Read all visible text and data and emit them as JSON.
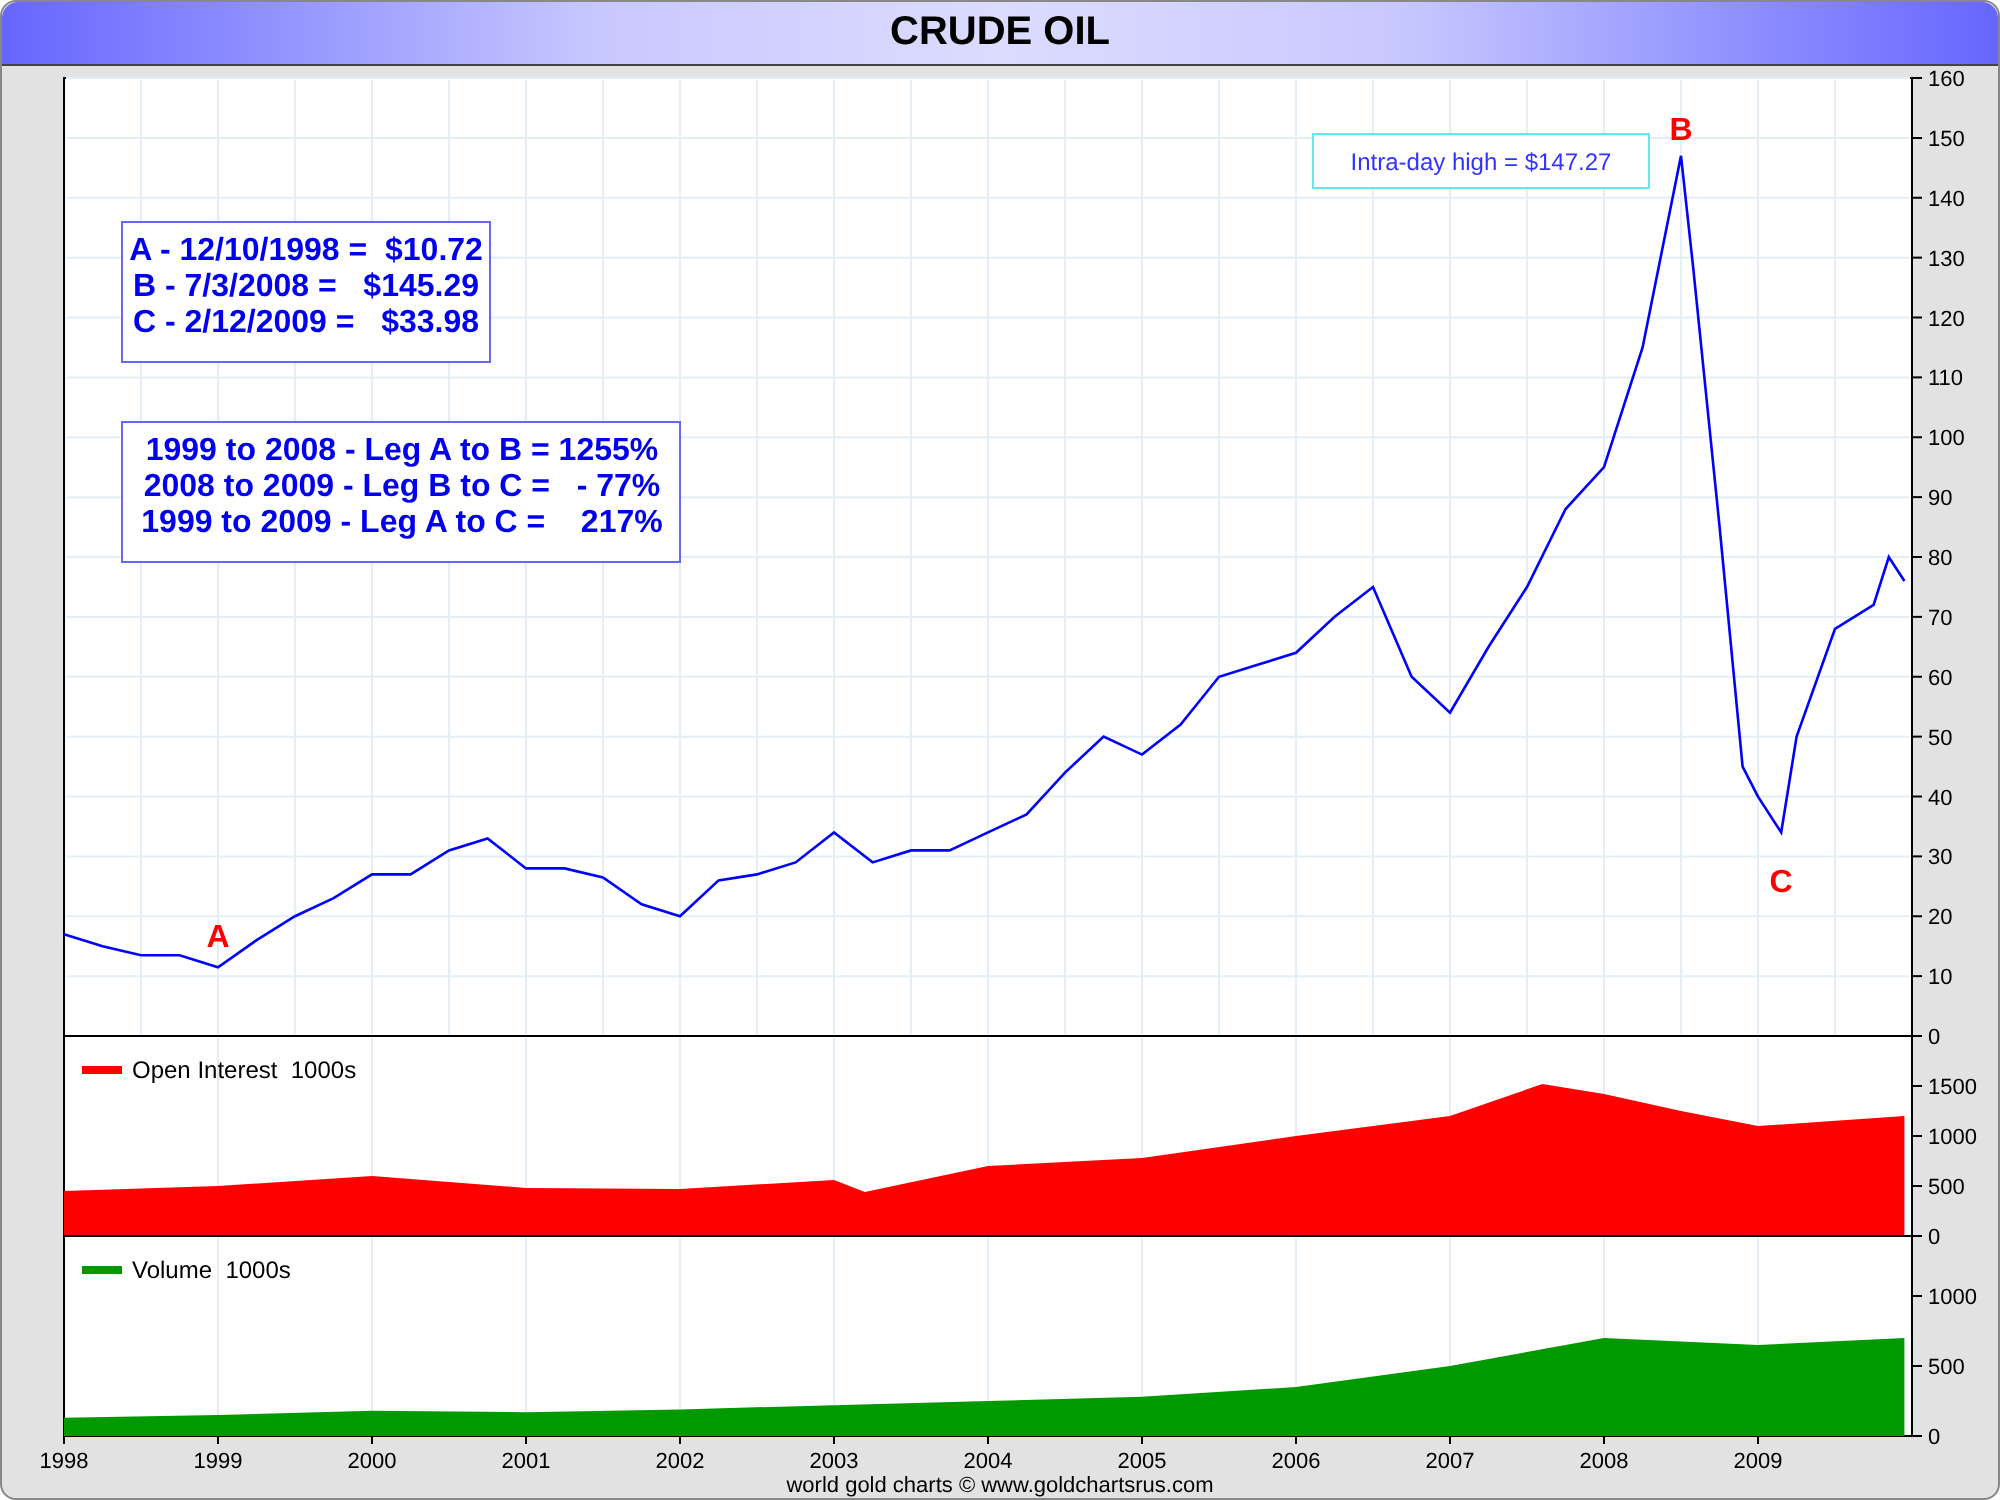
{
  "title": "CRUDE OIL",
  "price_chart": {
    "chart_data": {
      "type": "line",
      "grid": true,
      "xlim": [
        1998,
        2010
      ],
      "ylim": [
        0,
        160
      ],
      "yticks": [
        0,
        10,
        20,
        30,
        40,
        50,
        60,
        70,
        80,
        90,
        100,
        110,
        120,
        130,
        140,
        150,
        160
      ],
      "x": [
        1998.0,
        1998.25,
        1998.5,
        1998.75,
        1999.0,
        1999.25,
        1999.5,
        1999.75,
        2000.0,
        2000.25,
        2000.5,
        2000.75,
        2001.0,
        2001.25,
        2001.5,
        2001.75,
        2002.0,
        2002.25,
        2002.5,
        2002.75,
        2003.0,
        2003.25,
        2003.5,
        2003.75,
        2004.0,
        2004.25,
        2004.5,
        2004.75,
        2005.0,
        2005.25,
        2005.5,
        2005.75,
        2006.0,
        2006.25,
        2006.5,
        2006.75,
        2007.0,
        2007.25,
        2007.5,
        2007.75,
        2008.0,
        2008.25,
        2008.5,
        2008.58,
        2008.75,
        2008.9,
        2009.0,
        2009.15,
        2009.25,
        2009.5,
        2009.75,
        2009.85,
        2009.95
      ],
      "series": [
        {
          "color": "#0000ff",
          "values": [
            17,
            15,
            13.5,
            13.5,
            11.5,
            16,
            20,
            23,
            27,
            27,
            31,
            33,
            28,
            28,
            26.5,
            22,
            20,
            26,
            27,
            29,
            34,
            29,
            31,
            31,
            34,
            37,
            44,
            50,
            47,
            52,
            60,
            62,
            64,
            70,
            75,
            60,
            54,
            65,
            75,
            88,
            95,
            115,
            147,
            128,
            85,
            45,
            40,
            34,
            50,
            68,
            72,
            80,
            76
          ]
        }
      ],
      "annotations": [
        "A",
        "B",
        "C",
        "Intra-day high = $147.27"
      ]
    },
    "price_box": [
      "A - 12/10/1998 =  $10.72",
      "B - 7/3/2008 =   $145.29",
      "C - 2/12/2009 =   $33.98"
    ],
    "legs_box": [
      "1999 to 2008 - Leg A to B = 1255%",
      "2008 to 2009 - Leg B to C =   - 77%",
      "1999 to 2009 - Leg A to C =    217%"
    ]
  },
  "open_interest_chart": {
    "chart_data": {
      "type": "area",
      "grid": true,
      "xlim": [
        1998,
        2010
      ],
      "ylim": [
        0,
        2000
      ],
      "yticks": [
        0,
        500,
        1000,
        1500
      ],
      "x": [
        1998.0,
        1999.0,
        2000.0,
        2001.0,
        2002.0,
        2003.0,
        2003.2,
        2004.0,
        2005.0,
        2006.0,
        2007.0,
        2007.6,
        2008.0,
        2008.5,
        2009.0,
        2009.95
      ],
      "series": [
        {
          "name": "Open Interest  1000s",
          "color": "#ff0000",
          "values": [
            450,
            500,
            600,
            480,
            470,
            560,
            440,
            700,
            780,
            1000,
            1200,
            1520,
            1420,
            1250,
            1100,
            1200
          ]
        }
      ]
    }
  },
  "volume_chart": {
    "chart_data": {
      "type": "area",
      "grid": true,
      "xlim": [
        1998,
        2010
      ],
      "ylim": [
        0,
        1400
      ],
      "yticks": [
        0,
        500,
        1000
      ],
      "xticks": [
        {
          "value": 1998,
          "label": "1998"
        },
        {
          "value": 1999,
          "label": "1999"
        },
        {
          "value": 2000,
          "label": "2000"
        },
        {
          "value": 2001,
          "label": "2001"
        },
        {
          "value": 2002,
          "label": "2002"
        },
        {
          "value": 2003,
          "label": "2003"
        },
        {
          "value": 2004,
          "label": "2004"
        },
        {
          "value": 2005,
          "label": "2005"
        },
        {
          "value": 2006,
          "label": "2006"
        },
        {
          "value": 2007,
          "label": "2007"
        },
        {
          "value": 2008,
          "label": "2008"
        },
        {
          "value": 2009,
          "label": "2009"
        }
      ],
      "x": [
        1998.0,
        1999.0,
        2000.0,
        2001.0,
        2002.0,
        2003.0,
        2004.0,
        2005.0,
        2006.0,
        2007.0,
        2008.0,
        2009.0,
        2009.95
      ],
      "series": [
        {
          "name": "Volume  1000s",
          "color": "#009900",
          "values": [
            130,
            150,
            180,
            170,
            190,
            220,
            250,
            280,
            350,
            500,
            700,
            650,
            700
          ]
        }
      ]
    }
  },
  "footer": "world gold charts © www.goldchartsrus.com"
}
